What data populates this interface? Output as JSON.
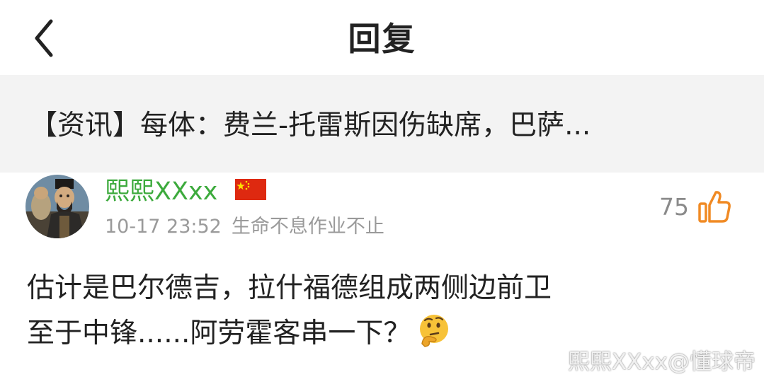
{
  "header": {
    "title": "回复",
    "back_icon": "chevron-left-icon"
  },
  "article": {
    "title": "【资讯】每体：费兰-托雷斯因伤缺席，巴萨..."
  },
  "reply": {
    "username": "熙熙XXxx",
    "flag_icon": "china-flag-icon",
    "timestamp": "10-17 23:52",
    "signature": "生命不息作业不止",
    "like_count": "75",
    "like_icon": "thumbs-up-icon",
    "like_color": "#f08a24",
    "username_color": "#3caa3c",
    "body_line1": "估计是巴尔德吉，拉什福德组成两侧边前卫",
    "body_line2": "至于中锋......阿劳霍客串一下？",
    "emoji": "thinking-face-icon"
  },
  "watermark": "熙熙XXxx@懂球帝"
}
